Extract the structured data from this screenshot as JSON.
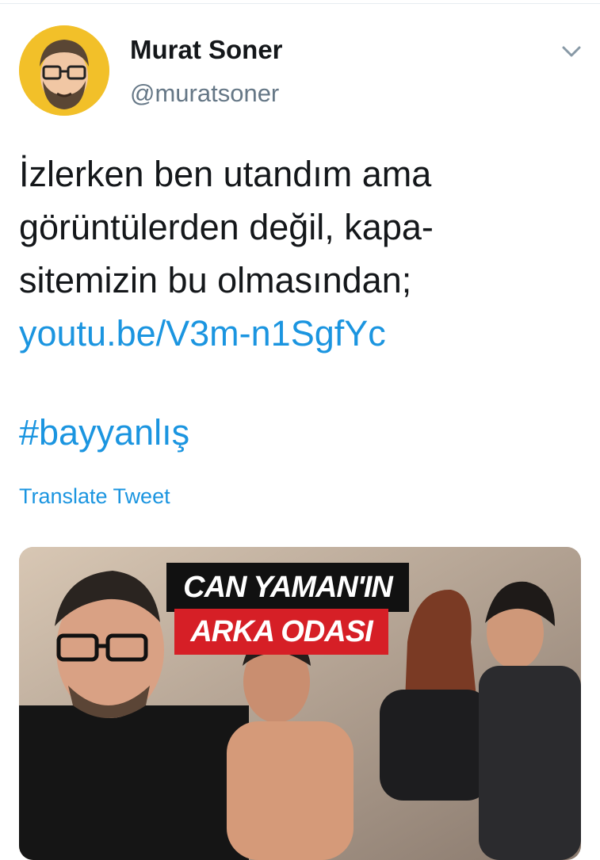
{
  "tweet": {
    "author_name": "Murat Soner",
    "author_handle": "@muratsoner",
    "text_lines": [
      "İzlerken ben utandım ama",
      "görüntülerden değil, kapa-",
      "sitemizin bu olmasından;"
    ],
    "link": "youtu.be/V3m-n1SgfYc",
    "hashtag": "#bayyanlış",
    "translate_label": "Translate Tweet"
  },
  "media": {
    "headline_line1": "CAN YAMAN'IN",
    "headline_line2": "ARKA ODASI"
  },
  "icons": {
    "menu": "chevron-down-icon"
  },
  "colors": {
    "link": "#1b95e0",
    "text": "#14171a",
    "secondary": "#657786",
    "avatar_bg": "#f2c029",
    "headline_red": "#d61f26"
  }
}
